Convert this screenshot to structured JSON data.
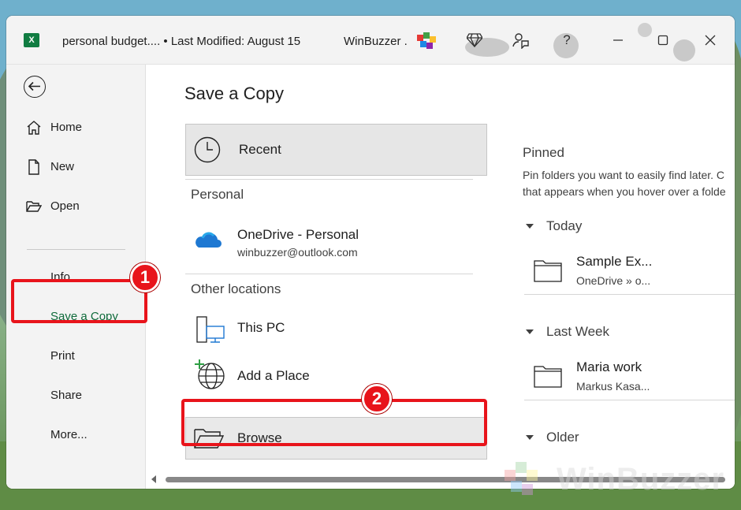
{
  "titlebar": {
    "document_title": "personal budget.... • Last Modified: August 15",
    "app_name": "WinBuzzer .",
    "buttons": [
      "premium-icon",
      "coauthor-icon",
      "help-icon",
      "minimize-icon",
      "maximize-icon",
      "close-icon"
    ],
    "help_label": "?"
  },
  "sidebar": {
    "items": [
      {
        "label": "Home",
        "icon": "home-icon"
      },
      {
        "label": "New",
        "icon": "new-document-icon"
      },
      {
        "label": "Open",
        "icon": "open-folder-icon"
      },
      {
        "label": "Info"
      },
      {
        "label": "Save a Copy",
        "active": true
      },
      {
        "label": "Print"
      },
      {
        "label": "Share"
      },
      {
        "label": "More..."
      }
    ]
  },
  "main": {
    "title": "Save a Copy",
    "recent_label": "Recent",
    "personal_heading": "Personal",
    "onedrive": {
      "label": "OneDrive - Personal",
      "account": "winbuzzer@outlook.com"
    },
    "other_heading": "Other locations",
    "this_pc_label": "This PC",
    "add_place_label": "Add a Place",
    "browse_label": "Browse"
  },
  "pinned": {
    "heading": "Pinned",
    "description_line1": "Pin folders you want to easily find later. C",
    "description_line2": "that appears when you hover over a folde",
    "groups": [
      {
        "label": "Today",
        "folders": [
          {
            "name": "Sample Ex...",
            "path": "OneDrive » o..."
          }
        ]
      },
      {
        "label": "Last Week",
        "folders": [
          {
            "name": "Maria work",
            "path": "Markus Kasa..."
          }
        ]
      },
      {
        "label": "Older",
        "folders": []
      }
    ]
  },
  "callouts": [
    "1",
    "2"
  ],
  "watermark": "WinBuzzer",
  "colors": {
    "accent_green": "#107c41",
    "callout_red": "#e8141b",
    "active_text": "#0f6b3b"
  }
}
